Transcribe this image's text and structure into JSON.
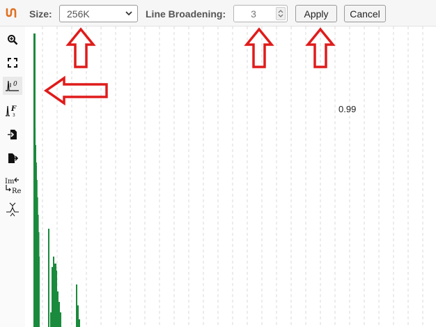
{
  "toolbar": {
    "logo_icon": "spectrum-logo-icon",
    "size_label": "Size:",
    "size_value": "256K",
    "line_broadening_label": "Line Broadening:",
    "line_broadening_value": "3",
    "apply_label": "Apply",
    "cancel_label": "Cancel"
  },
  "sidebar": {
    "tools": [
      {
        "name": "zoom-in-icon"
      },
      {
        "name": "fit-to-screen-icon"
      },
      {
        "name": "phase-correction-icon"
      },
      {
        "name": "fourier-transform-icon"
      },
      {
        "name": "import-icon"
      },
      {
        "name": "export-icon"
      },
      {
        "name": "real-imaginary-icon"
      },
      {
        "name": "peak-picking-icon"
      }
    ]
  },
  "plot": {
    "annotation": "0.99",
    "line_color": "#1a8a3c",
    "grid_color": "#d8d8d8"
  },
  "callouts": {
    "arrow_color": "#e01b1b"
  }
}
